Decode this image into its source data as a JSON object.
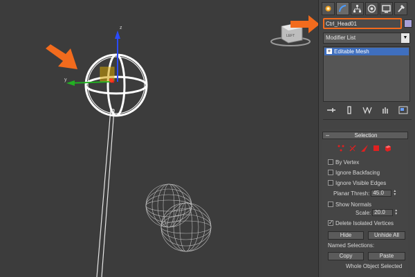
{
  "viewport": {
    "axis_labels": {
      "z": "z",
      "y": "y"
    },
    "viewcube_label": "LEFT"
  },
  "command_panel": {
    "tabs": [
      "create-tab",
      "modify-tab",
      "hierarchy-tab",
      "motion-tab",
      "display-tab",
      "utilities-tab"
    ],
    "object_name": "Ctrl_Head01",
    "object_color": "#a7a0d8",
    "modifier_list_label": "Modifier List",
    "stack_items": [
      "Editable Mesh"
    ],
    "selection_rollout": {
      "title": "Selection",
      "minus": "–",
      "checkboxes": [
        {
          "label": "By Vertex",
          "checked": false
        },
        {
          "label": "Ignore Backfacing",
          "checked": false
        },
        {
          "label": "Ignore Visible Edges",
          "checked": false
        },
        {
          "label": "Show Normals",
          "checked": false
        },
        {
          "label": "Delete Isolated Vertices",
          "checked": true
        }
      ],
      "planar_thresh_label": "Planar Thresh:",
      "planar_thresh_value": "45.0",
      "scale_label": "Scale:",
      "scale_value": "20.0",
      "hide_label": "Hide",
      "unhide_all_label": "Unhide All",
      "named_selections_label": "Named Selections:",
      "copy_label": "Copy",
      "paste_label": "Paste",
      "status": "Whole Object Selected"
    }
  },
  "colors": {
    "highlight_orange": "#f26b1d",
    "selection_blue": "#3f6fbf",
    "gizmo_red": "#d62020",
    "gizmo_yellow": "#f0c000"
  }
}
